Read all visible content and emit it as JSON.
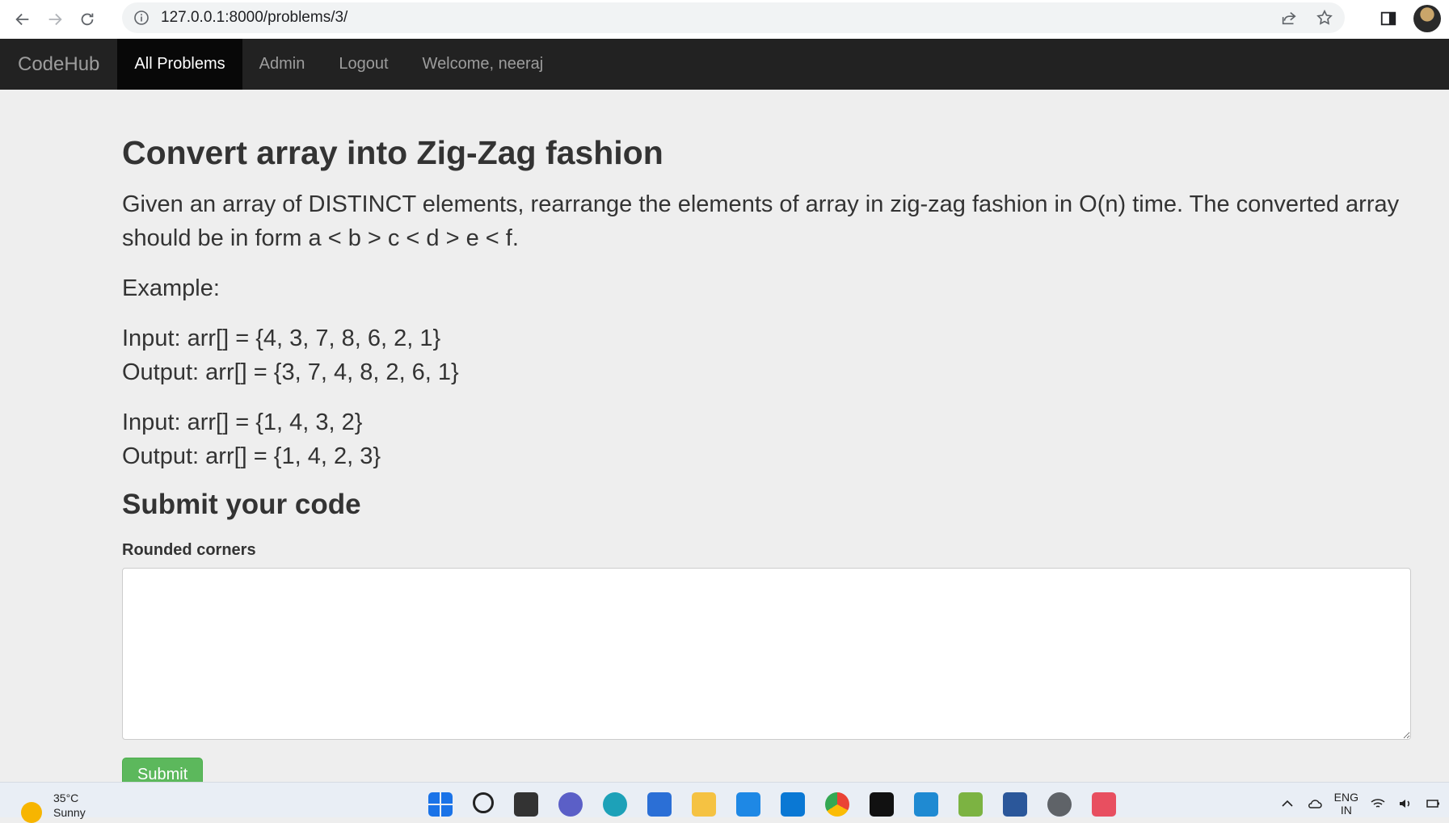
{
  "browser": {
    "url": "127.0.0.1:8000/problems/3/"
  },
  "navbar": {
    "brand": "CodeHub",
    "items": [
      {
        "label": "All Problems",
        "active": true
      },
      {
        "label": "Admin",
        "active": false
      },
      {
        "label": "Logout",
        "active": false
      }
    ],
    "welcome": "Welcome, neeraj"
  },
  "problem": {
    "title": "Convert array into Zig-Zag fashion",
    "description": "Given an array of DISTINCT elements, rearrange the elements of array in zig-zag fashion in O(n) time. The converted array should be in form a < b > c < d > e < f.",
    "example_label": "Example:",
    "examples": [
      {
        "input": "Input: arr[] = {4, 3, 7, 8, 6, 2, 1}",
        "output": "Output: arr[] = {3, 7, 4, 8, 2, 6, 1}"
      },
      {
        "input": "Input: arr[] = {1, 4, 3, 2}",
        "output": "Output: arr[] = {1, 4, 2, 3}"
      }
    ]
  },
  "submit_section": {
    "title": "Submit your code",
    "field_label": "Rounded corners",
    "code_value": "",
    "submit_label": "Submit"
  },
  "taskbar": {
    "temperature": "35°C",
    "condition": "Sunny",
    "language_line1": "ENG",
    "language_line2": "IN",
    "apps": [
      "windows-start",
      "search",
      "task-view",
      "teams",
      "edge",
      "store",
      "file-explorer",
      "app-l",
      "outlook",
      "chrome",
      "terminal",
      "vscode",
      "notepad-paint",
      "word",
      "settings",
      "snipping-tool"
    ]
  },
  "colors": {
    "navbar_bg": "#222222",
    "navbar_active_bg": "#080808",
    "page_bg": "#eeeeee",
    "submit_bg": "#5cb85c"
  }
}
